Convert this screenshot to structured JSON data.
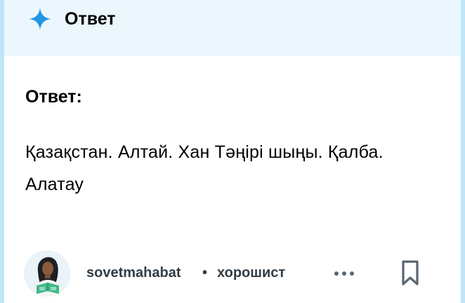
{
  "header": {
    "icon": "sparkle-icon",
    "title": "Ответ",
    "accent_color": "#2196e3",
    "background_color": "#ebf7fc"
  },
  "answer": {
    "label": "Ответ:",
    "line1": "Қазақстан. Алтай. Хан Тәңірі шыңы. Қалба.",
    "line2": "Алатау"
  },
  "author": {
    "avatar": "avatar-icon",
    "username": "sovetmahabat",
    "separator": "•",
    "rank": "хорошист"
  },
  "actions": {
    "more_icon": "more-options-icon",
    "bookmark_icon": "bookmark-icon"
  }
}
